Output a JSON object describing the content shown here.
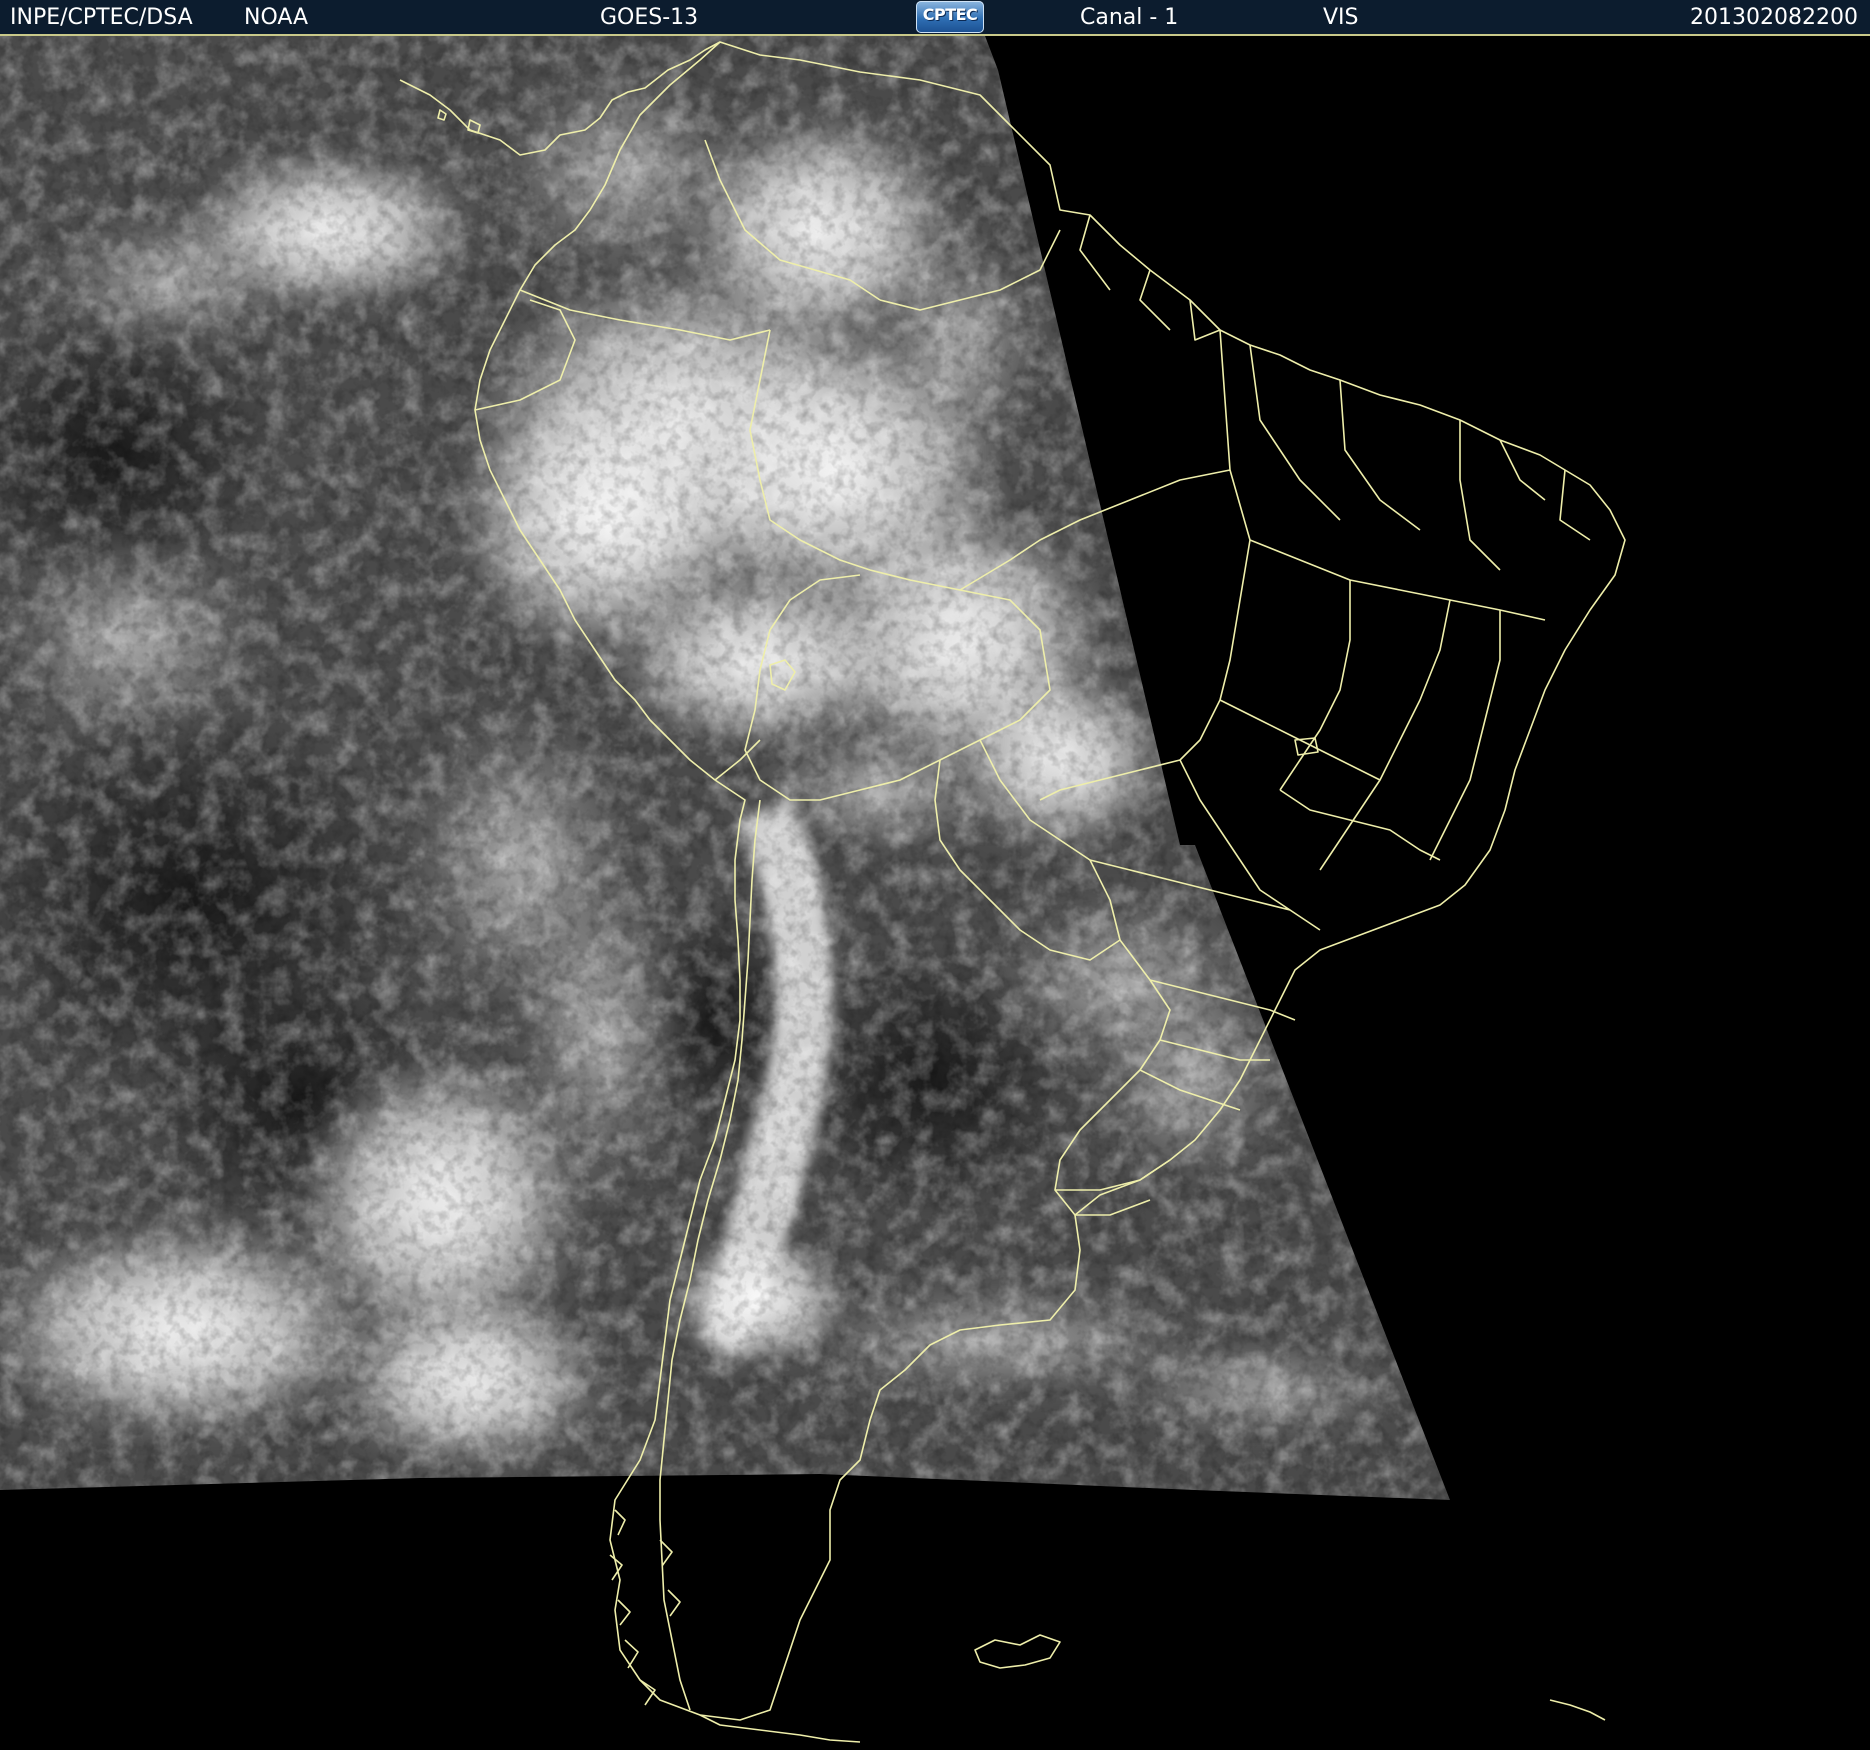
{
  "header": {
    "agency": "INPE/CPTEC/DSA",
    "source": "NOAA",
    "satellite": "GOES-13",
    "logo_text": "CPTEC",
    "channel": "Canal - 1",
    "band": "VIS",
    "timestamp": "201302082200"
  },
  "colors": {
    "header_background": "#0c1c2e",
    "header_text": "#ffffff",
    "border_lines": "#eeeeaa",
    "no_data_background": "#000000",
    "ocean_gray": "#4a4a4a",
    "cloud_white": "#f2f2f2"
  },
  "map": {
    "type": "satellite visible-channel imagery",
    "region": "South America",
    "overlay": "country and state boundary lines"
  }
}
